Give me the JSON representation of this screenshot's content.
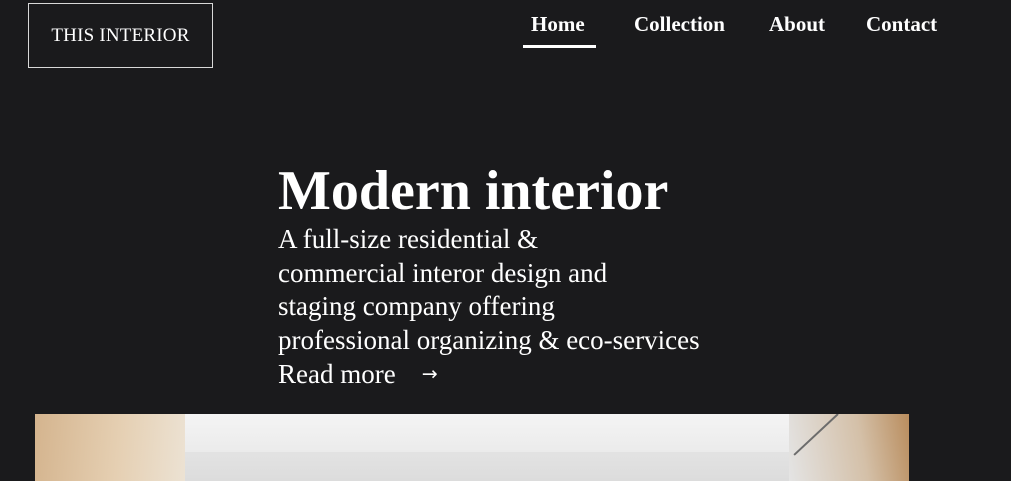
{
  "logo": {
    "text": "THIS INTERIOR"
  },
  "nav": {
    "items": [
      {
        "label": "Home",
        "active": true
      },
      {
        "label": "Collection",
        "active": false
      },
      {
        "label": "About",
        "active": false
      },
      {
        "label": "Contact",
        "active": false
      }
    ]
  },
  "hero": {
    "title": "Modern interior",
    "description_lines": [
      "A full-size residential &",
      "commercial interor design and",
      "staging company offering",
      "professional organizing & eco-services"
    ],
    "read_more_label": "Read more",
    "read_more_icon": "arrow-right-icon",
    "read_more_glyph": "→"
  },
  "colors": {
    "background": "#1a1a1c",
    "text": "#ffffff",
    "logo_border": "#d8d8d8"
  }
}
